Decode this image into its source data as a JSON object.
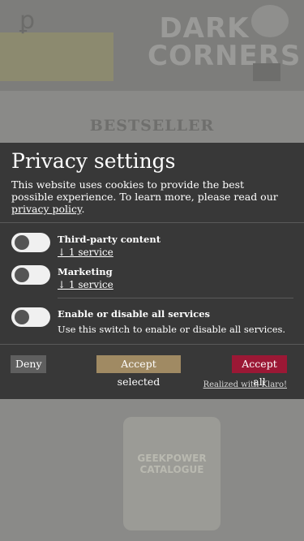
{
  "background": {
    "logo_glyph": "ꝑ",
    "site_title_line1": "DARK",
    "site_title_line2": "CORNERS",
    "section_title": "BESTSELLER",
    "product_label_line1": "GEEKPOWER",
    "product_label_line2": "CATALOGUE"
  },
  "modal": {
    "title": "Privacy settings",
    "description": "This website uses cookies to provide the best possible experience. To learn more, please read our ",
    "privacy_link": "privacy policy",
    "description_end": ".",
    "services": [
      {
        "title": "Third-party content",
        "link": "↓ 1 service",
        "enabled": false
      },
      {
        "title": "Marketing",
        "link": "↓ 1 service",
        "enabled": false
      }
    ],
    "all_services": {
      "title": "Enable or disable all services",
      "description": "Use this switch to enable or disable all services.",
      "enabled": false
    },
    "buttons": {
      "deny": "Deny",
      "accept_selected": "Accept selected",
      "accept_all": "Accept all"
    },
    "realized_with": "Realized with Klaro!"
  },
  "colors": {
    "modal_bg": "#383838",
    "deny": "#5f5f5f",
    "accept_selected": "#a08a63",
    "accept_all": "#9b1835"
  }
}
